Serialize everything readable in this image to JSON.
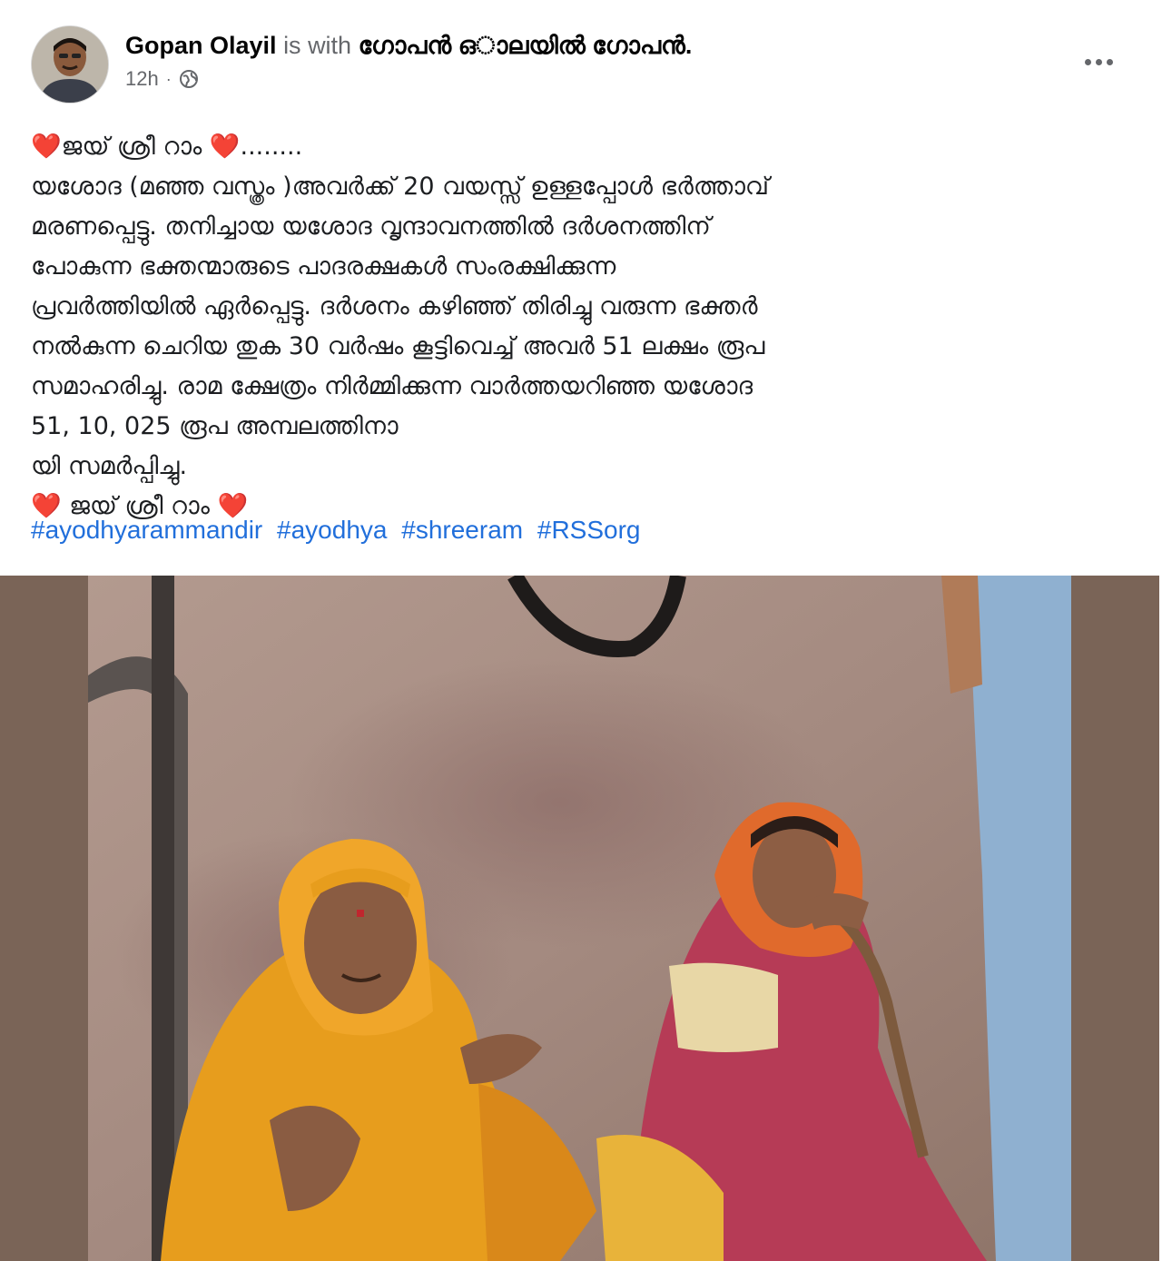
{
  "post": {
    "author": "Gopan Olayil",
    "with_text": "is with",
    "tagged": "ഗോപൻ ഒാലയിൽ ഗോപൻ.",
    "timestamp": "12h",
    "audience_icon": "globe-icon",
    "more_icon": "more-options-icon",
    "text_lines": [
      "❤️ജയ് ശ്രീ റാം ❤️........",
      "യശോദ (മഞ്ഞ വസ്ത്രം )അവർക്ക് 20 വയസ്സ് ഉള്ളപ്പോൾ ഭർത്താവ്",
      "മരണപ്പെട്ടു. തനിച്ചായ യശോദ വൃന്ദാവനത്തിൽ ദർശനത്തിന്",
      "പോകുന്ന ഭക്തന്മാരുടെ പാദരക്ഷകൾ സംരക്ഷിക്കുന്ന",
      "പ്രവർത്തിയിൽ ഏർപ്പെട്ടു. ദർശനം കഴിഞ്ഞ് തിരിച്ചു വരുന്ന ഭക്തർ",
      "നൽകുന്ന ചെറിയ തുക 30 വർഷം കൂട്ടിവെച്ച് അവർ 51 ലക്ഷം രൂപ",
      "സമാഹരിച്ചു. രാമ ക്ഷേത്രം നിർമ്മിക്കുന്ന വാർത്തയറിഞ്ഞ യശോദ",
      "51, 10, 025 രൂപ അമ്പലത്തിനാ",
      "യി സമർപ്പിച്ചു.",
      "  ❤️ ജയ് ശ്രീ റാം ❤️"
    ],
    "hashtags": [
      "#ayodhyarammandir",
      "#ayodhya",
      "#shreeram",
      "#RSSorg"
    ]
  },
  "colors": {
    "link": "#216fdb",
    "secondary_text": "#65676b",
    "heart": "#e0245e"
  }
}
